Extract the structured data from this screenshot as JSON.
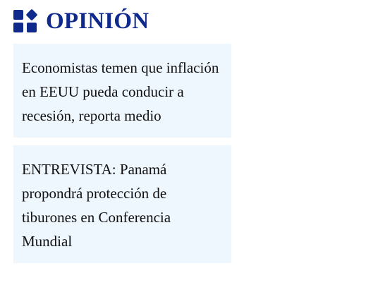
{
  "section": {
    "title": "OPINIÓN",
    "icon": "widgets-icon",
    "accent_color": "#0f2a8c",
    "card_background": "#eef6fe"
  },
  "articles": [
    {
      "headline": "Economistas temen que inflación en EEUU pueda conducir a recesión, reporta medio"
    },
    {
      "headline": "ENTREVISTA: Panamá propondrá protección de tiburones en Conferencia Mundial"
    }
  ]
}
